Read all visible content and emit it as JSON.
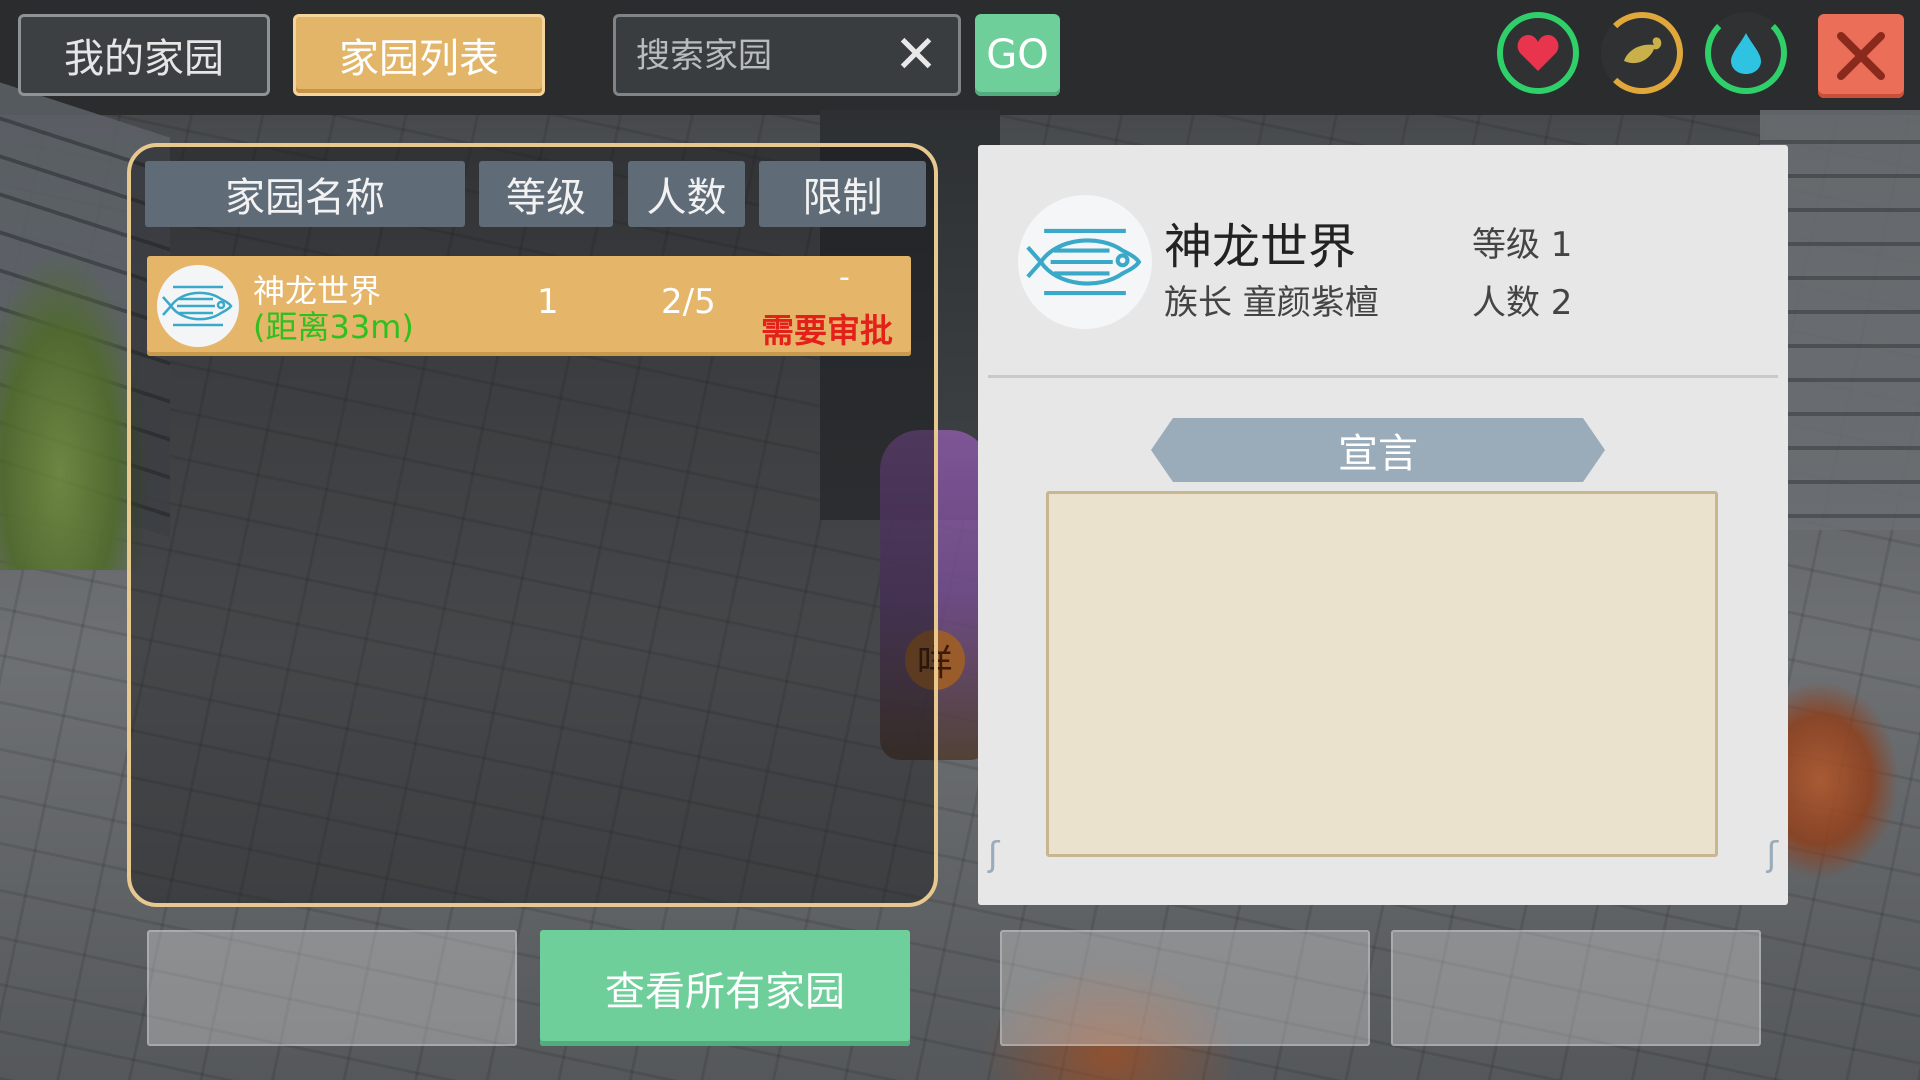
{
  "top_bar": {
    "tab_my_home": "我的家园",
    "tab_home_list": "家园列表",
    "search_placeholder": "搜索家园",
    "go_label": "GO",
    "status_icons": [
      "heart-icon",
      "food-icon",
      "water-icon"
    ]
  },
  "list": {
    "columns": [
      "家园名称",
      "等级",
      "人数",
      "限制"
    ],
    "rows": [
      {
        "name": "神龙世界",
        "distance": "(距离33m)",
        "level": "1",
        "members": "2/5",
        "limit_dash": "-",
        "limit": "需要审批",
        "icon": "fish-emblem-icon"
      }
    ]
  },
  "detail": {
    "name": "神龙世界",
    "leader": "族长  童颜紫檀",
    "level": "等级 1",
    "members": "人数 2",
    "declaration_title": "宣言",
    "declaration_text": ""
  },
  "bottom": {
    "view_all_label": "查看所有家园"
  },
  "world": {
    "character_badge": "咩"
  },
  "colors": {
    "accent_gold": "#e3b568",
    "accent_green": "#6fcf9b",
    "close_red": "#ea6e58",
    "distance_green": "#2fbf1f",
    "approval_red": "#e4201a"
  }
}
